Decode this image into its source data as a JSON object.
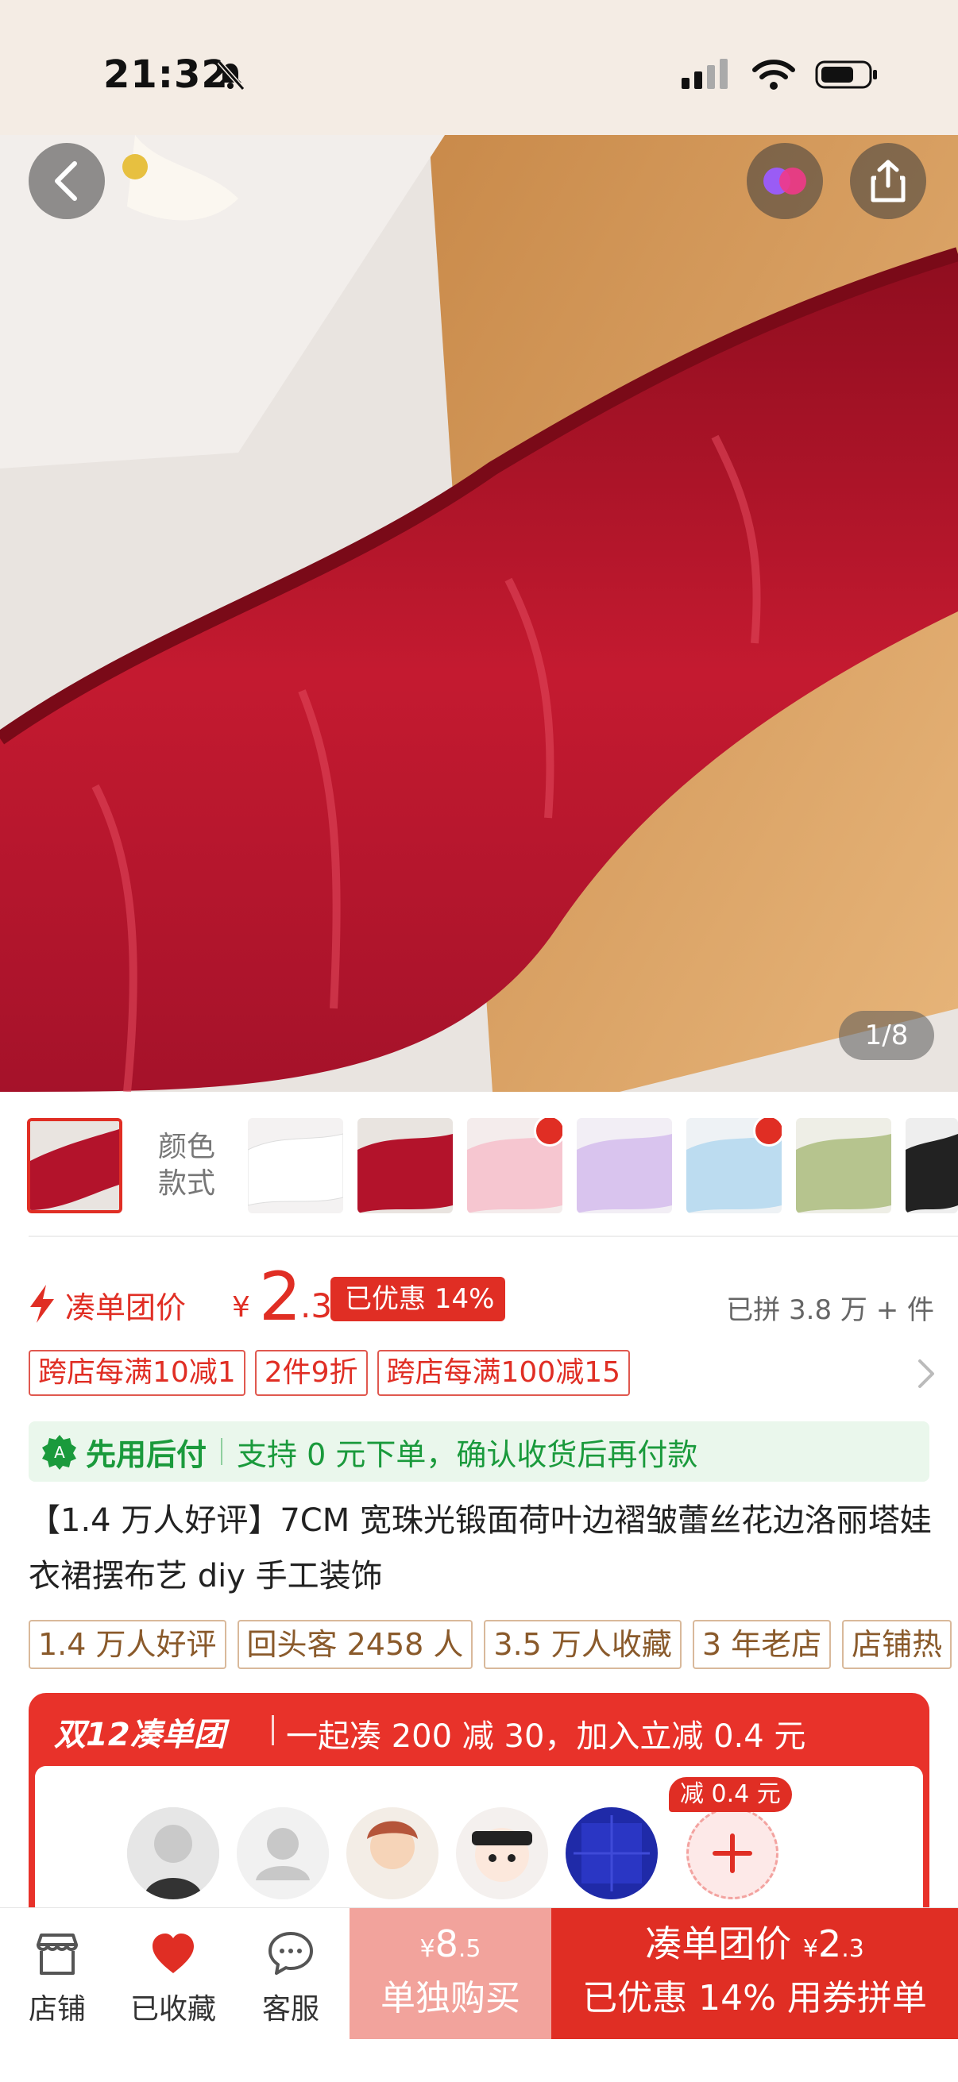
{
  "status": {
    "time": "21:32"
  },
  "hero": {
    "counter": "1/8"
  },
  "thumbnails": {
    "color_label_line1": "颜色",
    "color_label_line2": "款式"
  },
  "price": {
    "label": "凑单团价",
    "currency": "¥",
    "integer": "2",
    "decimal": ".3",
    "discount_badge": "已优惠 14%",
    "sold": "已拼 3.8 万 + 件"
  },
  "coupons": [
    "跨店每满10减1",
    "2件9折",
    "跨店每满100减15"
  ],
  "paylater": {
    "title": "先用后付",
    "desc": "支持 0 元下单，确认收货后再付款"
  },
  "product": {
    "title": "【1.4 万人好评】7CM 宽珠光锻面荷叶边褶皱蕾丝花边洛丽塔娃衣裙摆布艺 diy 手工装饰"
  },
  "tags": [
    "1.4 万人好评",
    "回头客 2458 人",
    "3.5 万人收藏",
    "3 年老店",
    "店铺热"
  ],
  "group": {
    "title": "双12凑单团",
    "text": "一起凑 200 减 30，加入立减 0.4 元",
    "reduce_badge": "减 0.4 元"
  },
  "bottom": {
    "store": "店铺",
    "favorited": "已收藏",
    "service": "客服",
    "single_price_currency": "¥",
    "single_price": "8",
    "single_price_dec": ".5",
    "single_label": "单独购买",
    "group_label": "凑单团价",
    "group_price_currency": "¥",
    "group_price": "2",
    "group_price_dec": ".3",
    "group_sub": "已优惠 14% 用券拼单"
  },
  "colors": {
    "accent": "#e02e24",
    "green": "#1a9a3c",
    "fabric": "#b3132b"
  }
}
